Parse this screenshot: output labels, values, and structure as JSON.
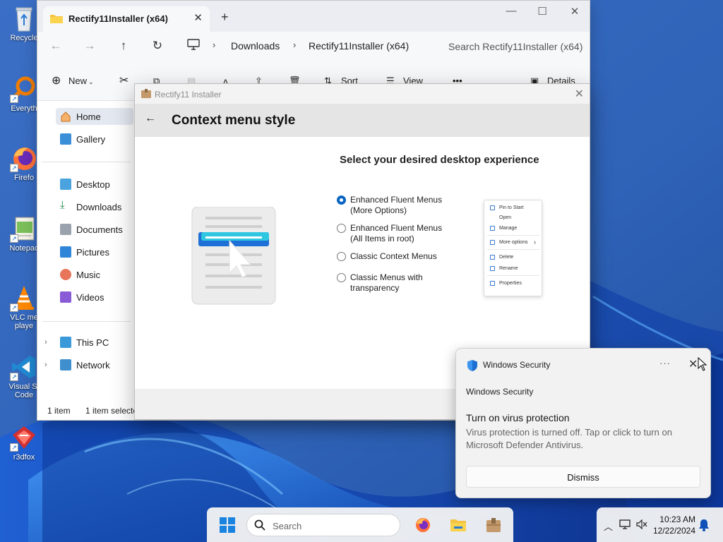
{
  "desktop": {
    "icons": [
      {
        "label": "Recycle",
        "icon": "recycle-bin-icon"
      },
      {
        "label": "Everyth",
        "icon": "everything-search-icon"
      },
      {
        "label": "Firefo",
        "icon": "firefox-icon"
      },
      {
        "label": "Notepac",
        "icon": "notepad-icon"
      },
      {
        "label": "VLC me",
        "label2": "playe",
        "icon": "vlc-icon"
      },
      {
        "label": "Visual St",
        "label2": "Code",
        "icon": "vscode-icon"
      },
      {
        "label": "r3dfox",
        "icon": "r3dfox-icon"
      }
    ]
  },
  "explorer": {
    "tab_title": "Rectify11Installer (x64)",
    "breadcrumb": [
      "Downloads",
      "Rectify11Installer (x64)"
    ],
    "search_placeholder": "Search Rectify11Installer (x64)",
    "toolbar": {
      "new_label": "New",
      "sort_label": "Sort",
      "view_label": "View",
      "details_label": "Details"
    },
    "nav": {
      "home": "Home",
      "gallery": "Gallery",
      "desktop": "Desktop",
      "downloads": "Downloads",
      "documents": "Documents",
      "pictures": "Pictures",
      "music": "Music",
      "videos": "Videos",
      "this_pc": "This PC",
      "network": "Network"
    },
    "status": {
      "count": "1 item",
      "selected": "1 item selecte"
    }
  },
  "installer": {
    "window_title": "Rectify11 Installer",
    "page_title": "Context menu style",
    "subtitle": "Select your desired desktop experience",
    "options": [
      {
        "line1": "Enhanced Fluent Menus",
        "line2": "(More Options)",
        "checked": true
      },
      {
        "line1": "Enhanced Fluent Menus",
        "line2": "(All Items in root)",
        "checked": false
      },
      {
        "line1": "Classic Context Menus",
        "line2": "",
        "checked": false
      },
      {
        "line1": "Classic Menus with",
        "line2": "transparency",
        "checked": false
      }
    ],
    "preview_menu": [
      "Pin to Start",
      "Open",
      "Manage",
      "More options",
      "Delete",
      "Rename",
      "Properties"
    ],
    "accent_color": "#0a66c2"
  },
  "toast": {
    "app_name": "Windows Security",
    "more": "···",
    "source": "Windows Security",
    "heading": "Turn on virus protection",
    "body": "Virus protection is turned off. Tap or click to turn on Microsoft Defender Antivirus.",
    "dismiss_label": "Dismiss"
  },
  "taskbar": {
    "search_placeholder": "Search",
    "time": "10:23 AM",
    "date": "12/22/2024"
  }
}
